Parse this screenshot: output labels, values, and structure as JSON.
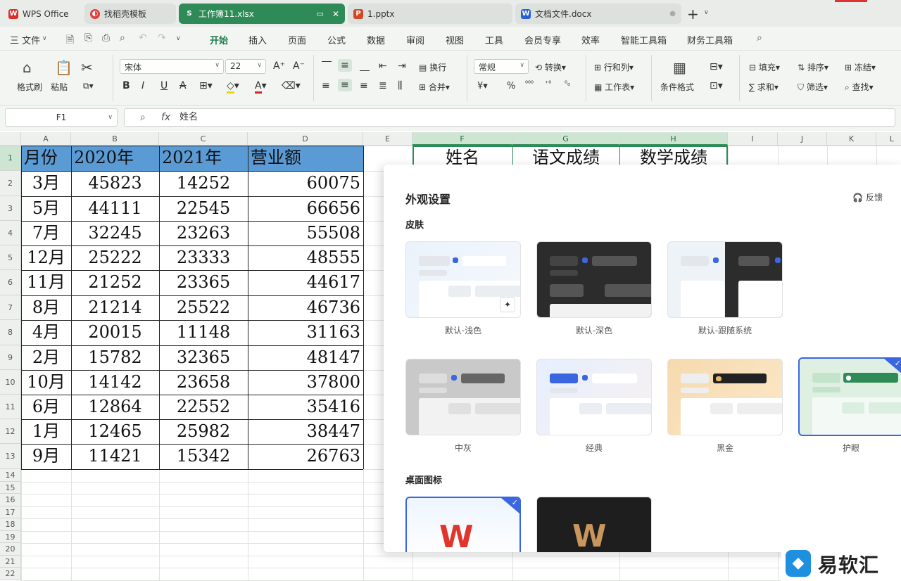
{
  "tabs": [
    {
      "label": "WPS Office",
      "icon": "wps-logo-icon"
    },
    {
      "label": "找稻壳模板",
      "icon": "docer-icon"
    },
    {
      "label": "工作簿11.xlsx",
      "icon": "sheet-icon",
      "active": true
    },
    {
      "label": "1.pptx",
      "icon": "ppt-icon"
    },
    {
      "label": "文档文件.docx",
      "icon": "doc-icon"
    }
  ],
  "menu": {
    "file": "三 文件",
    "items": [
      "开始",
      "插入",
      "页面",
      "公式",
      "数据",
      "审阅",
      "视图",
      "工具",
      "会员专享",
      "效率",
      "智能工具箱",
      "财务工具箱"
    ],
    "active": "开始"
  },
  "ribbon": {
    "format_painter": "格式刷",
    "paste": "粘贴",
    "font_name": "宋体",
    "font_size": "22",
    "wrap": "换行",
    "merge": "合并",
    "number_format": "常规",
    "convert": "转换",
    "rows_cols": "行和列",
    "worksheet": "工作表",
    "cond_format": "条件格式",
    "fill": "填充",
    "sort": "排序",
    "freeze": "冻结",
    "sum": "求和",
    "filter": "筛选",
    "find": "查找"
  },
  "formula": {
    "cell_ref": "F1",
    "value": "姓名"
  },
  "sheet": {
    "columns": [
      "A",
      "B",
      "C",
      "D",
      "E",
      "F",
      "G",
      "H",
      "I",
      "J",
      "K",
      "L"
    ],
    "rows": [
      "1",
      "2",
      "3",
      "4",
      "5",
      "6",
      "7",
      "8",
      "9",
      "10",
      "11",
      "12",
      "13",
      "14",
      "15",
      "16",
      "17",
      "18",
      "19",
      "20",
      "21",
      "22"
    ],
    "header": [
      "月份",
      "2020年",
      "2021年",
      "营业额"
    ],
    "data": [
      [
        "3月",
        "45823",
        "14252",
        "60075"
      ],
      [
        "5月",
        "44111",
        "22545",
        "66656"
      ],
      [
        "7月",
        "32245",
        "23263",
        "55508"
      ],
      [
        "12月",
        "25222",
        "23333",
        "48555"
      ],
      [
        "11月",
        "21252",
        "23365",
        "44617"
      ],
      [
        "8月",
        "21214",
        "25522",
        "46736"
      ],
      [
        "4月",
        "20015",
        "11148",
        "31163"
      ],
      [
        "2月",
        "15782",
        "32365",
        "48147"
      ],
      [
        "10月",
        "14142",
        "23658",
        "37800"
      ],
      [
        "6月",
        "12864",
        "22552",
        "35416"
      ],
      [
        "1月",
        "12465",
        "25982",
        "38447"
      ],
      [
        "9月",
        "11421",
        "15342",
        "26763"
      ]
    ],
    "right_header": [
      "姓名",
      "语文成绩",
      "数学成绩"
    ],
    "header_color": "#5b9bd5"
  },
  "panel": {
    "title": "外观设置",
    "feedback": "反馈",
    "skin_section": "皮肤",
    "skins": [
      "默认-浅色",
      "默认-深色",
      "默认-跟随系统",
      "中灰",
      "经典",
      "黑金",
      "护眼"
    ],
    "selected_skin": "护眼",
    "desktop_section": "桌面图标",
    "accent": "#3a67e0"
  },
  "watermark": {
    "text": "易软汇"
  }
}
